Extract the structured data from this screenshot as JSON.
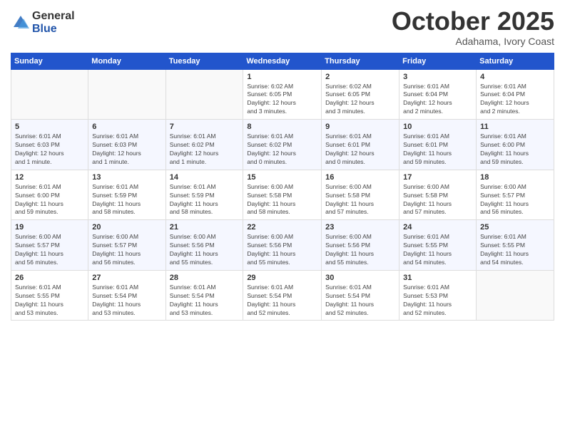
{
  "logo": {
    "general": "General",
    "blue": "Blue"
  },
  "header": {
    "month": "October 2025",
    "location": "Adahama, Ivory Coast"
  },
  "weekdays": [
    "Sunday",
    "Monday",
    "Tuesday",
    "Wednesday",
    "Thursday",
    "Friday",
    "Saturday"
  ],
  "weeks": [
    [
      {
        "day": "",
        "info": ""
      },
      {
        "day": "",
        "info": ""
      },
      {
        "day": "",
        "info": ""
      },
      {
        "day": "1",
        "info": "Sunrise: 6:02 AM\nSunset: 6:05 PM\nDaylight: 12 hours\nand 3 minutes."
      },
      {
        "day": "2",
        "info": "Sunrise: 6:02 AM\nSunset: 6:05 PM\nDaylight: 12 hours\nand 3 minutes."
      },
      {
        "day": "3",
        "info": "Sunrise: 6:01 AM\nSunset: 6:04 PM\nDaylight: 12 hours\nand 2 minutes."
      },
      {
        "day": "4",
        "info": "Sunrise: 6:01 AM\nSunset: 6:04 PM\nDaylight: 12 hours\nand 2 minutes."
      }
    ],
    [
      {
        "day": "5",
        "info": "Sunrise: 6:01 AM\nSunset: 6:03 PM\nDaylight: 12 hours\nand 1 minute."
      },
      {
        "day": "6",
        "info": "Sunrise: 6:01 AM\nSunset: 6:03 PM\nDaylight: 12 hours\nand 1 minute."
      },
      {
        "day": "7",
        "info": "Sunrise: 6:01 AM\nSunset: 6:02 PM\nDaylight: 12 hours\nand 1 minute."
      },
      {
        "day": "8",
        "info": "Sunrise: 6:01 AM\nSunset: 6:02 PM\nDaylight: 12 hours\nand 0 minutes."
      },
      {
        "day": "9",
        "info": "Sunrise: 6:01 AM\nSunset: 6:01 PM\nDaylight: 12 hours\nand 0 minutes."
      },
      {
        "day": "10",
        "info": "Sunrise: 6:01 AM\nSunset: 6:01 PM\nDaylight: 11 hours\nand 59 minutes."
      },
      {
        "day": "11",
        "info": "Sunrise: 6:01 AM\nSunset: 6:00 PM\nDaylight: 11 hours\nand 59 minutes."
      }
    ],
    [
      {
        "day": "12",
        "info": "Sunrise: 6:01 AM\nSunset: 6:00 PM\nDaylight: 11 hours\nand 59 minutes."
      },
      {
        "day": "13",
        "info": "Sunrise: 6:01 AM\nSunset: 5:59 PM\nDaylight: 11 hours\nand 58 minutes."
      },
      {
        "day": "14",
        "info": "Sunrise: 6:01 AM\nSunset: 5:59 PM\nDaylight: 11 hours\nand 58 minutes."
      },
      {
        "day": "15",
        "info": "Sunrise: 6:00 AM\nSunset: 5:58 PM\nDaylight: 11 hours\nand 58 minutes."
      },
      {
        "day": "16",
        "info": "Sunrise: 6:00 AM\nSunset: 5:58 PM\nDaylight: 11 hours\nand 57 minutes."
      },
      {
        "day": "17",
        "info": "Sunrise: 6:00 AM\nSunset: 5:58 PM\nDaylight: 11 hours\nand 57 minutes."
      },
      {
        "day": "18",
        "info": "Sunrise: 6:00 AM\nSunset: 5:57 PM\nDaylight: 11 hours\nand 56 minutes."
      }
    ],
    [
      {
        "day": "19",
        "info": "Sunrise: 6:00 AM\nSunset: 5:57 PM\nDaylight: 11 hours\nand 56 minutes."
      },
      {
        "day": "20",
        "info": "Sunrise: 6:00 AM\nSunset: 5:57 PM\nDaylight: 11 hours\nand 56 minutes."
      },
      {
        "day": "21",
        "info": "Sunrise: 6:00 AM\nSunset: 5:56 PM\nDaylight: 11 hours\nand 55 minutes."
      },
      {
        "day": "22",
        "info": "Sunrise: 6:00 AM\nSunset: 5:56 PM\nDaylight: 11 hours\nand 55 minutes."
      },
      {
        "day": "23",
        "info": "Sunrise: 6:00 AM\nSunset: 5:56 PM\nDaylight: 11 hours\nand 55 minutes."
      },
      {
        "day": "24",
        "info": "Sunrise: 6:01 AM\nSunset: 5:55 PM\nDaylight: 11 hours\nand 54 minutes."
      },
      {
        "day": "25",
        "info": "Sunrise: 6:01 AM\nSunset: 5:55 PM\nDaylight: 11 hours\nand 54 minutes."
      }
    ],
    [
      {
        "day": "26",
        "info": "Sunrise: 6:01 AM\nSunset: 5:55 PM\nDaylight: 11 hours\nand 53 minutes."
      },
      {
        "day": "27",
        "info": "Sunrise: 6:01 AM\nSunset: 5:54 PM\nDaylight: 11 hours\nand 53 minutes."
      },
      {
        "day": "28",
        "info": "Sunrise: 6:01 AM\nSunset: 5:54 PM\nDaylight: 11 hours\nand 53 minutes."
      },
      {
        "day": "29",
        "info": "Sunrise: 6:01 AM\nSunset: 5:54 PM\nDaylight: 11 hours\nand 52 minutes."
      },
      {
        "day": "30",
        "info": "Sunrise: 6:01 AM\nSunset: 5:54 PM\nDaylight: 11 hours\nand 52 minutes."
      },
      {
        "day": "31",
        "info": "Sunrise: 6:01 AM\nSunset: 5:53 PM\nDaylight: 11 hours\nand 52 minutes."
      },
      {
        "day": "",
        "info": ""
      }
    ]
  ]
}
